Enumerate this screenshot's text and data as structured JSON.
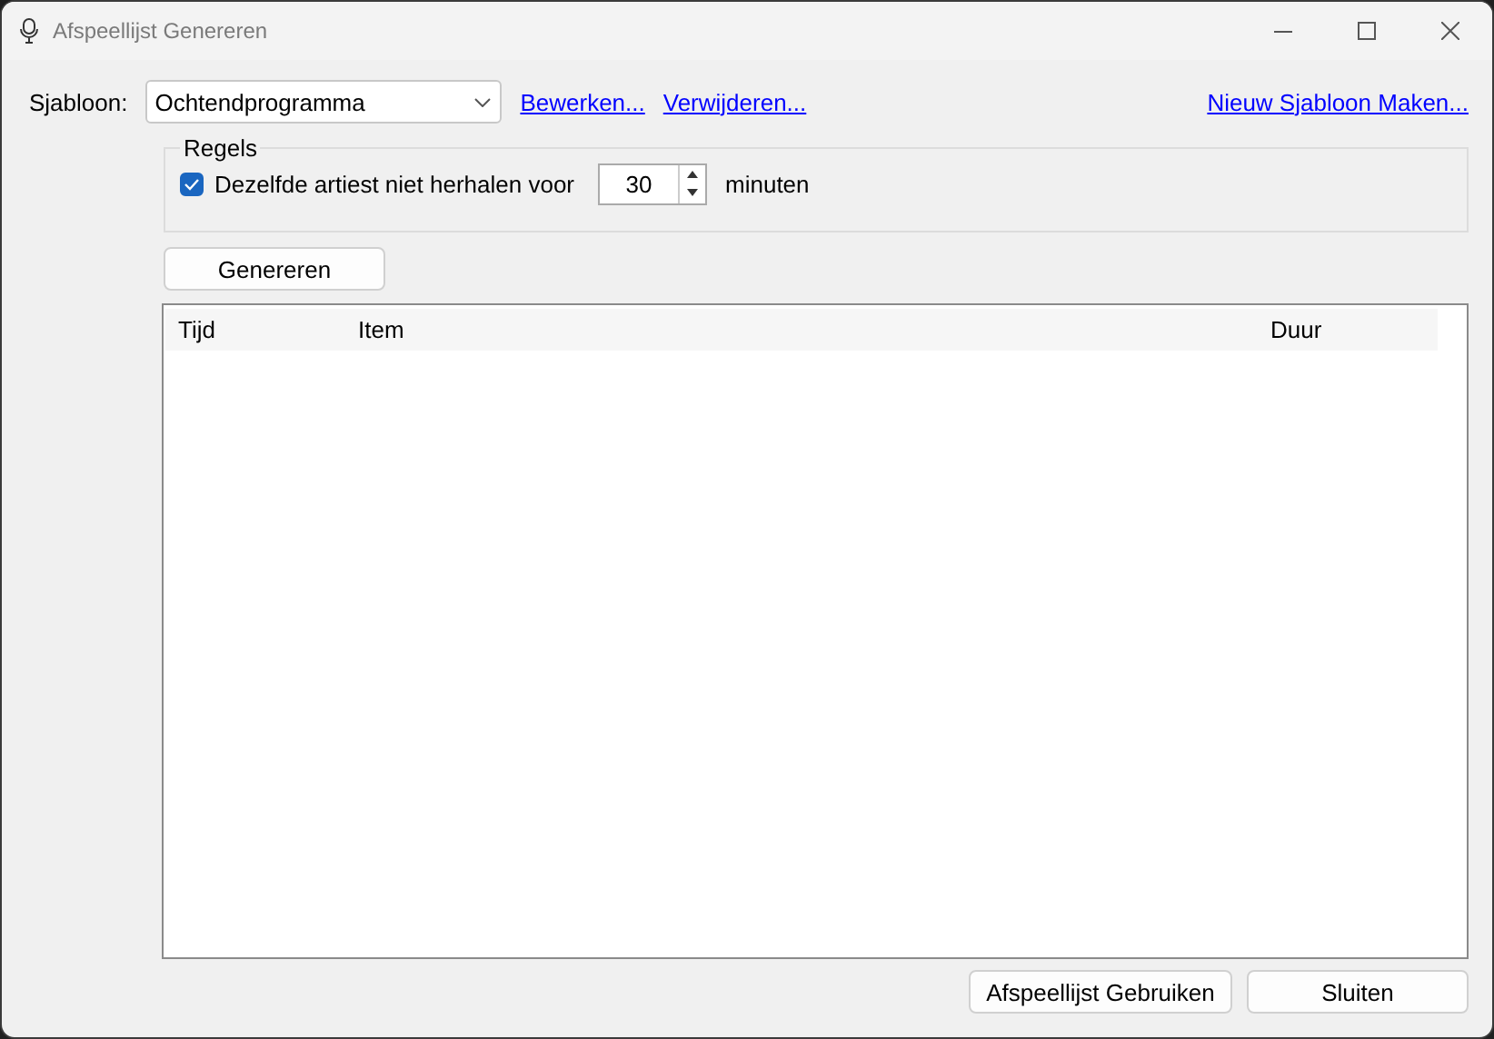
{
  "window": {
    "title": "Afspeellijst Genereren"
  },
  "template": {
    "label": "Sjabloon:",
    "value": "Ochtendprogramma",
    "links": [
      "Bewerken...",
      "Verwijderen..."
    ],
    "new_link": "Nieuw Sjabloon Maken..."
  },
  "rules": {
    "title": "Regels",
    "checkbox": {
      "label": "Dezelfde artiest niet herhalen voor",
      "checked": true
    },
    "spin_value": "30",
    "unit": "minuten"
  },
  "generate_button": "Genereren",
  "table": {
    "columns": [
      "Tijd",
      "Item",
      "Duur"
    ]
  },
  "buttons": [
    "Afspeellijst Gebruiken",
    "Sluiten"
  ]
}
